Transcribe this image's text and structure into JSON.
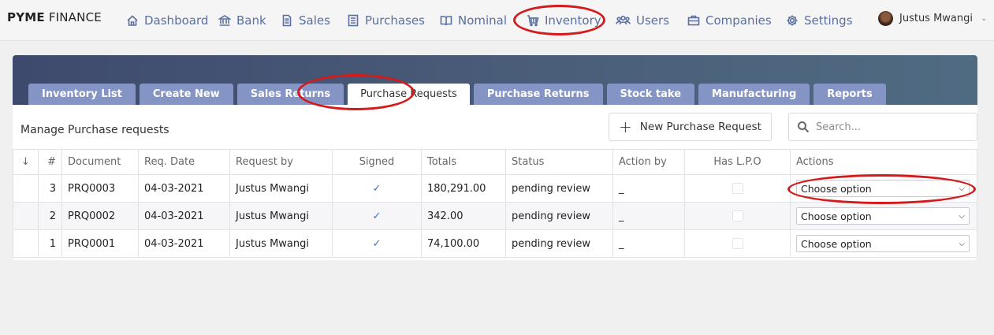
{
  "brand": {
    "bold": "PYME",
    "light": "FINANCE"
  },
  "nav": [
    {
      "label": "Dashboard",
      "icon": "home-icon"
    },
    {
      "label": "Bank",
      "icon": "bank-icon"
    },
    {
      "label": "Sales",
      "icon": "document-icon"
    },
    {
      "label": "Purchases",
      "icon": "list-icon"
    },
    {
      "label": "Nominal",
      "icon": "book-icon"
    },
    {
      "label": "Inventory",
      "icon": "cart-icon"
    },
    {
      "label": "Users",
      "icon": "users-icon"
    },
    {
      "label": "Companies",
      "icon": "briefcase-icon"
    },
    {
      "label": "Settings",
      "icon": "gear-icon"
    }
  ],
  "user": {
    "name": "Justus Mwangi"
  },
  "tabs": [
    "Inventory List",
    "Create New",
    "Sales Returns",
    "Purchase Requests",
    "Purchase Returns",
    "Stock take",
    "Manufacturing",
    "Reports"
  ],
  "active_tab": "Purchase Requests",
  "page": {
    "title": "Manage Purchase requests",
    "new_button": "New Purchase Request",
    "search_placeholder": "Search..."
  },
  "table": {
    "headers": [
      "#",
      "Document",
      "Req. Date",
      "Request by",
      "Signed",
      "Totals",
      "Status",
      "Action by",
      "Has L.P.O",
      "Actions"
    ],
    "rows": [
      {
        "num": "3",
        "document": "PRQ0003",
        "date": "04-03-2021",
        "request_by": "Justus Mwangi",
        "signed": true,
        "totals": "180,291.00",
        "status": "pending review",
        "action_by": "_",
        "action": "Choose option"
      },
      {
        "num": "2",
        "document": "PRQ0002",
        "date": "04-03-2021",
        "request_by": "Justus Mwangi",
        "signed": true,
        "totals": "342.00",
        "status": "pending review",
        "action_by": "_",
        "action": "Choose option"
      },
      {
        "num": "1",
        "document": "PRQ0001",
        "date": "04-03-2021",
        "request_by": "Justus Mwangi",
        "signed": true,
        "totals": "74,100.00",
        "status": "pending review",
        "action_by": "_",
        "action": "Choose option"
      }
    ]
  },
  "colors": {
    "accent": "#5a6fa0",
    "tab": "#8494c4",
    "banner": "#3e4a6d",
    "annotation": "#d41a1a",
    "check": "#3b6fd1"
  }
}
